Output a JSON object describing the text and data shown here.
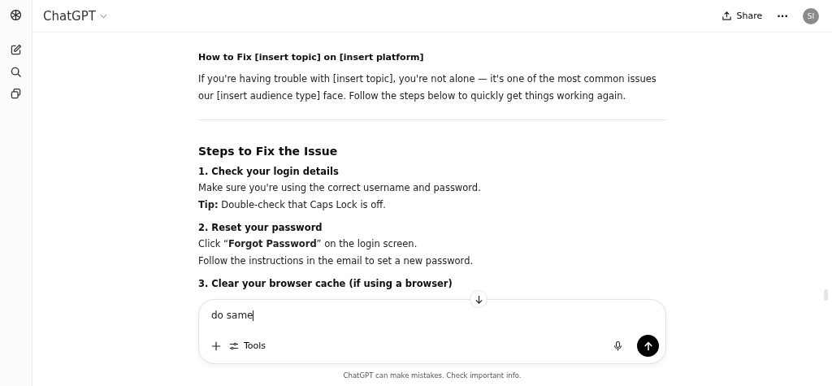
{
  "header": {
    "title": "ChatGPT",
    "share": "Share",
    "more": "···",
    "avatar": "SI"
  },
  "message": {
    "title": "How to Fix [insert topic] on [insert platform]",
    "intro": "If you're having trouble with [insert topic], you're not alone — it's one of the most common issues our [insert audience type] face. Follow the steps below to quickly get things working again.",
    "section_heading": "Steps to Fix the Issue",
    "steps": [
      {
        "heading": "1. Check your login details",
        "lines": [
          "Make sure you're using the correct username and password.",
          "**Tip:** Double-check that Caps Lock is off."
        ]
      },
      {
        "heading": "2. Reset your password",
        "lines": [
          "Click “**Forgot Password**” on the login screen.",
          "Follow the instructions in the email to set a new password."
        ]
      },
      {
        "heading": "3. Clear your browser cache (if using a browser)"
      }
    ]
  },
  "composer": {
    "value": "do same",
    "tools": "Tools"
  },
  "disclaimer": "ChatGPT can make mistakes. Check important info."
}
